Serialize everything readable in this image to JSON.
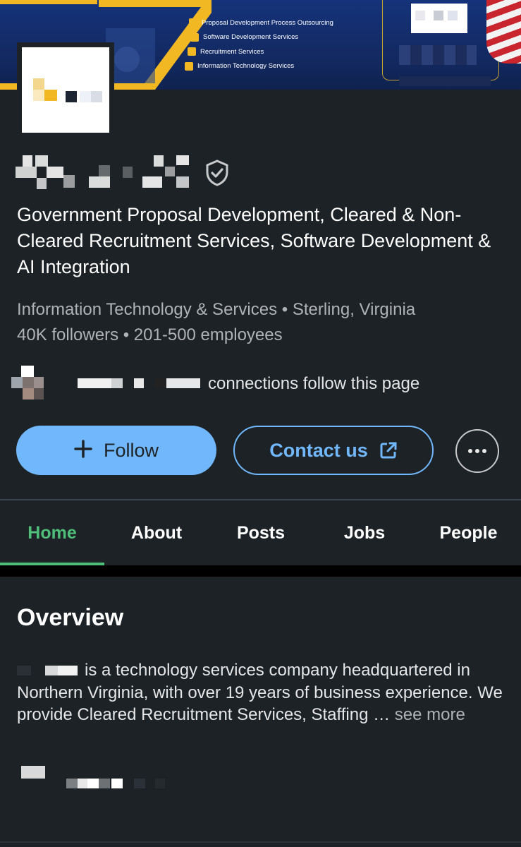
{
  "banner": {
    "services": [
      "Proposal Development Process Outsourcing",
      "Software Development Services",
      "Recruitment Services",
      "Information Technology Services"
    ]
  },
  "company": {
    "tagline": "Government Proposal Development, Cleared & Non-Cleared Recruitment Services, Software Development & AI Integration",
    "industry_location": "Information Technology & Services • Sterling, Virginia",
    "followers_employees": "40K followers • 201-500 employees",
    "connections_text": "connections follow this page"
  },
  "actions": {
    "follow_label": "Follow",
    "follow_icon": "plus-icon",
    "contact_label": "Contact us",
    "contact_icon": "external-link-icon",
    "more_icon": "ellipsis-icon"
  },
  "tabs": [
    {
      "label": "Home",
      "active": true
    },
    {
      "label": "About",
      "active": false
    },
    {
      "label": "Posts",
      "active": false
    },
    {
      "label": "Jobs",
      "active": false
    },
    {
      "label": "People",
      "active": false
    }
  ],
  "overview": {
    "title": "Overview",
    "body": "is a technology services company headquartered in Northern Virginia, with over 19 years of business experience. We provide Cleared Recruitment Services, Staffing …",
    "see_more": "see more"
  },
  "colors": {
    "accent_blue": "#71b7fb",
    "active_tab_green": "#4fbe79",
    "background": "#1d2226"
  }
}
